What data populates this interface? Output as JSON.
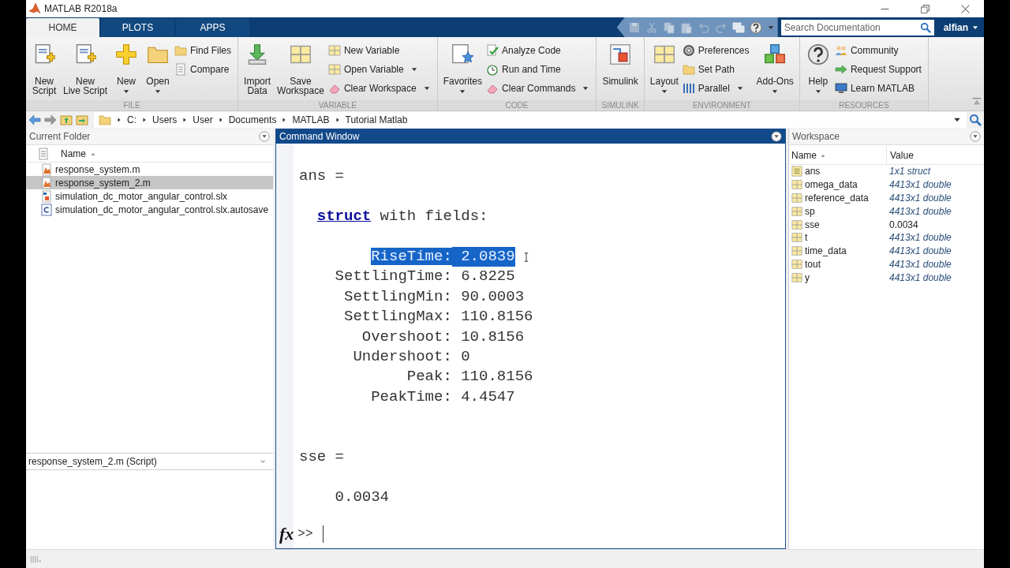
{
  "window": {
    "title": "MATLAB R2018a"
  },
  "tabs": [
    {
      "label": "HOME",
      "selected": true
    },
    {
      "label": "PLOTS",
      "selected": false
    },
    {
      "label": "APPS",
      "selected": false
    }
  ],
  "search": {
    "placeholder": "Search Documentation"
  },
  "user": {
    "name": "alfian"
  },
  "toolstrip": {
    "sections": [
      {
        "title": "FILE",
        "items": [
          {
            "kind": "large",
            "lines": [
              "New",
              "Script"
            ],
            "dropdown": false
          },
          {
            "kind": "large",
            "lines": [
              "New",
              "Live Script"
            ],
            "dropdown": false
          },
          {
            "kind": "large",
            "lines": [
              "New"
            ],
            "dropdown": true
          },
          {
            "kind": "large",
            "lines": [
              "Open"
            ],
            "dropdown": true
          },
          {
            "kind": "stack",
            "entries": [
              {
                "label": "Find Files",
                "dropdown": false
              },
              {
                "label": "Compare",
                "dropdown": false
              }
            ]
          }
        ]
      },
      {
        "title": "VARIABLE",
        "items": [
          {
            "kind": "large",
            "lines": [
              "Import",
              "Data"
            ],
            "dropdown": false
          },
          {
            "kind": "large",
            "lines": [
              "Save",
              "Workspace"
            ],
            "dropdown": false
          },
          {
            "kind": "stack",
            "entries": [
              {
                "label": "New Variable",
                "dropdown": false
              },
              {
                "label": "Open Variable",
                "dropdown": true
              },
              {
                "label": "Clear Workspace",
                "dropdown": true
              }
            ]
          }
        ]
      },
      {
        "title": "CODE",
        "items": [
          {
            "kind": "large",
            "lines": [
              "Favorites"
            ],
            "dropdown": true
          },
          {
            "kind": "stack",
            "entries": [
              {
                "label": "Analyze Code",
                "dropdown": false
              },
              {
                "label": "Run and Time",
                "dropdown": false
              },
              {
                "label": "Clear Commands",
                "dropdown": true
              }
            ]
          }
        ]
      },
      {
        "title": "SIMULINK",
        "items": [
          {
            "kind": "large",
            "lines": [
              "Simulink"
            ],
            "dropdown": false
          }
        ]
      },
      {
        "title": "ENVIRONMENT",
        "items": [
          {
            "kind": "large",
            "lines": [
              "Layout"
            ],
            "dropdown": true
          },
          {
            "kind": "stack",
            "entries": [
              {
                "label": "Preferences",
                "dropdown": false
              },
              {
                "label": "Set Path",
                "dropdown": false
              },
              {
                "label": "Parallel",
                "dropdown": true
              }
            ]
          },
          {
            "kind": "large",
            "lines": [
              "Add-Ons"
            ],
            "dropdown": true
          }
        ]
      },
      {
        "title": "RESOURCES",
        "items": [
          {
            "kind": "large",
            "lines": [
              "Help"
            ],
            "dropdown": true
          },
          {
            "kind": "stack",
            "entries": [
              {
                "label": "Community",
                "dropdown": false
              },
              {
                "label": "Request Support",
                "dropdown": false
              },
              {
                "label": "Learn MATLAB",
                "dropdown": false
              }
            ]
          }
        ]
      }
    ]
  },
  "address_bar": {
    "path": [
      "C:",
      "Users",
      "User",
      "Documents",
      "MATLAB",
      "Tutorial Matlab"
    ]
  },
  "current_folder": {
    "title": "Current Folder",
    "column": "Name",
    "files": [
      {
        "name": "response_system.m",
        "kind": "script",
        "selected": false
      },
      {
        "name": "response_system_2.m",
        "kind": "script",
        "selected": true
      },
      {
        "name": "simulation_dc_motor_angular_control.slx",
        "kind": "model",
        "selected": false
      },
      {
        "name": "simulation_dc_motor_angular_control.slx.autosave",
        "kind": "autosave",
        "selected": false
      }
    ],
    "details": "response_system_2.m  (Script)"
  },
  "command_window": {
    "title": "Command Window",
    "output": [
      {
        "kind": "blank"
      },
      {
        "kind": "text",
        "text": "ans ="
      },
      {
        "kind": "blank"
      },
      {
        "kind": "struct",
        "link": "struct",
        "text": "with fields:"
      },
      {
        "kind": "blank"
      },
      {
        "kind": "field",
        "name": "RiseTime:",
        "value": "2.0839",
        "selected": true
      },
      {
        "kind": "field",
        "name": "SettlingTime:",
        "value": "6.8225",
        "selected": false
      },
      {
        "kind": "field",
        "name": "SettlingMin:",
        "value": "90.0003",
        "selected": false
      },
      {
        "kind": "field",
        "name": "SettlingMax:",
        "value": "110.8156",
        "selected": false
      },
      {
        "kind": "field",
        "name": "Overshoot:",
        "value": "10.8156",
        "selected": false
      },
      {
        "kind": "field",
        "name": "Undershoot:",
        "value": "0",
        "selected": false
      },
      {
        "kind": "field",
        "name": "Peak:",
        "value": "110.8156",
        "selected": false
      },
      {
        "kind": "field",
        "name": "PeakTime:",
        "value": "4.4547",
        "selected": false
      },
      {
        "kind": "blank"
      },
      {
        "kind": "blank"
      },
      {
        "kind": "text",
        "text": "sse ="
      },
      {
        "kind": "blank"
      },
      {
        "kind": "value",
        "text": "0.0034"
      }
    ],
    "prompt_icon": "fx",
    "prompt": ">>"
  },
  "workspace": {
    "title": "Workspace",
    "columns": [
      "Name",
      "Value"
    ],
    "variables": [
      {
        "name": "ans",
        "value": "1x1 struct",
        "kind": "struct"
      },
      {
        "name": "omega_data",
        "value": "4413x1 double",
        "kind": "matrix"
      },
      {
        "name": "reference_data",
        "value": "4413x1 double",
        "kind": "matrix"
      },
      {
        "name": "sp",
        "value": "4413x1 double",
        "kind": "matrix"
      },
      {
        "name": "sse",
        "value": "0.0034",
        "kind": "scalar"
      },
      {
        "name": "t",
        "value": "4413x1 double",
        "kind": "matrix"
      },
      {
        "name": "time_data",
        "value": "4413x1 double",
        "kind": "matrix"
      },
      {
        "name": "tout",
        "value": "4413x1 double",
        "kind": "matrix"
      },
      {
        "name": "y",
        "value": "4413x1 double",
        "kind": "matrix"
      }
    ]
  }
}
